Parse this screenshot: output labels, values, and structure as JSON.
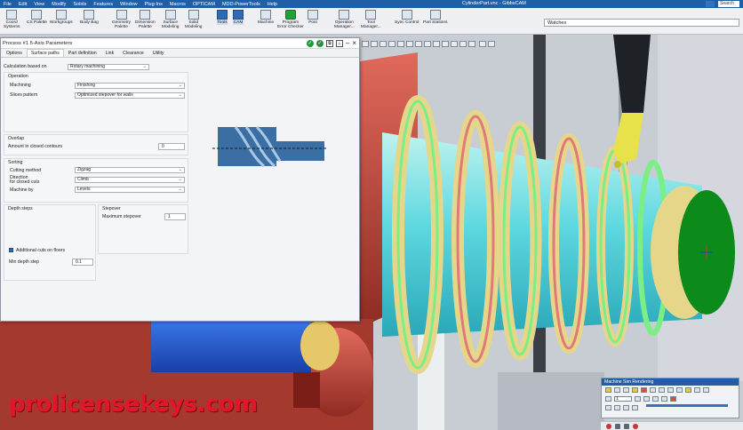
{
  "menubar": {
    "items": [
      "File",
      "Edit",
      "View",
      "Modify",
      "Solids",
      "Features",
      "Window",
      "Plug-Ins",
      "Macros",
      "OPTICAM",
      "MDD-PowerTools",
      "Help"
    ],
    "window_title": "CylinderPart.vnc - GibbsCAM",
    "search": "Search"
  },
  "ribbon": {
    "buttons": [
      {
        "label": "Coord\nSystems",
        "icon": "coord-systems-icon"
      },
      {
        "label": "CS Palette",
        "icon": "cs-palette-icon"
      },
      {
        "label": "Workgroups",
        "icon": "workgroups-icon"
      },
      {
        "label": "Body Bag",
        "icon": "body-bag-icon"
      },
      {
        "label": "Geometry\nPalette",
        "icon": "geometry-palette-icon"
      },
      {
        "label": "Dimension\nPalette",
        "icon": "dimension-palette-icon"
      },
      {
        "label": "Surface\nModeling",
        "icon": "surface-modeling-icon"
      },
      {
        "label": "Solid\nModeling",
        "icon": "solid-modeling-icon"
      },
      {
        "label": "Tools",
        "icon": "tools-icon"
      },
      {
        "label": "CAM",
        "icon": "cam-icon"
      },
      {
        "label": "Machine",
        "icon": "machine-icon"
      },
      {
        "label": "Program\nError Checker",
        "icon": "program-error-checker-icon"
      },
      {
        "label": "Post",
        "icon": "post-icon"
      },
      {
        "label": "Operation\nManager...",
        "icon": "operation-manager-icon"
      },
      {
        "label": "Tool\nManager...",
        "icon": "tool-manager-icon"
      },
      {
        "label": "Sync Control",
        "icon": "sync-control-icon"
      },
      {
        "label": "Part Stations",
        "icon": "part-stations-icon"
      }
    ],
    "watches": "Watches"
  },
  "dialog": {
    "title": "Process #1 5-Axis Parameters",
    "tabs": [
      "Options",
      "Surface paths",
      "Part definition",
      "Link",
      "Clearance",
      "Utility"
    ],
    "selected_tab": "Surface paths",
    "calculation_based_on": {
      "label": "Calculation based on",
      "value": "Rotary machining"
    },
    "operation": {
      "title": "Operation",
      "machining": {
        "label": "Machining",
        "value": "Finishing"
      },
      "slices_pattern": {
        "label": "Slices pattern",
        "value": "Optimized stepover for walls"
      }
    },
    "overlap": {
      "title": "Overlap",
      "amount": {
        "label": "Amount in closed contours",
        "value": "0"
      }
    },
    "sorting": {
      "title": "Sorting",
      "cutting_method": {
        "label": "Cutting method",
        "value": "Zigzag"
      },
      "direction": {
        "label": "Direction\nfor closed cuts",
        "value": "Climb"
      },
      "machine_by": {
        "label": "Machine by",
        "value": "Levels"
      }
    },
    "depth_steps": {
      "title": "Depth steps",
      "additional_cuts": "Additional cuts on floors",
      "min_depth_step": {
        "label": "Min depth step",
        "value": "0.1"
      }
    },
    "stepover": {
      "title": "Stepover",
      "max_stepover": {
        "label": "Maximum stepover",
        "value": "1"
      }
    }
  },
  "sim_panel": {
    "title": "Machine Sim Rendering",
    "field_value": "1"
  },
  "watermark": "prolicensekeys.com"
}
